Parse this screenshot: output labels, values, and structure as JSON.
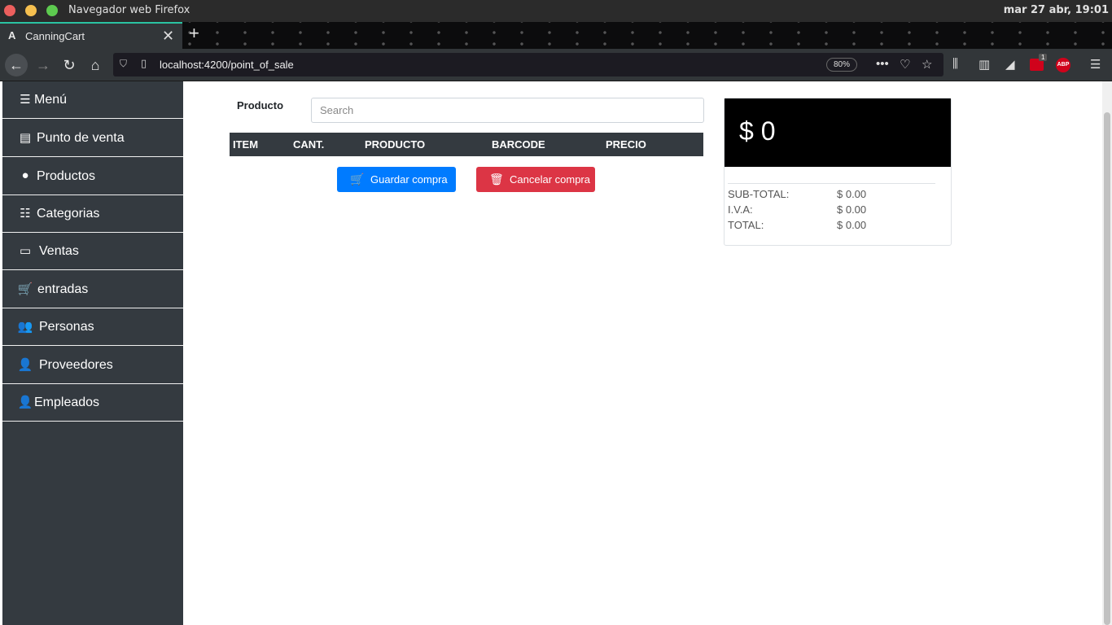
{
  "os": {
    "app_title": "Navegador web Firefox",
    "clock": "mar 27 abr, 19:01"
  },
  "browser": {
    "tab_title": "CanningCart",
    "tab_favicon": "A",
    "url": "localhost:4200/point_of_sale",
    "zoom": "80%",
    "extension_badge": "1",
    "abp_label": "ABP"
  },
  "sidebar": {
    "items": [
      {
        "label": "Menú",
        "icon": "bars-icon",
        "glyph": "☰"
      },
      {
        "label": "Punto de venta",
        "icon": "cash-register-icon",
        "glyph": "▤"
      },
      {
        "label": "Productos",
        "icon": "cookie-icon",
        "glyph": "●"
      },
      {
        "label": "Categorias",
        "icon": "list-icon",
        "glyph": "☷"
      },
      {
        "label": "Ventas",
        "icon": "money-bill-icon",
        "glyph": "▭"
      },
      {
        "label": "entradas",
        "icon": "shopping-cart-icon",
        "glyph": "🛒"
      },
      {
        "label": "Personas",
        "icon": "users-icon",
        "glyph": "👥"
      },
      {
        "label": "Proveedores",
        "icon": "user-tag-icon",
        "glyph": "👤"
      },
      {
        "label": "Empleados",
        "icon": "user-tie-icon",
        "glyph": "👤"
      }
    ]
  },
  "main": {
    "product_label": "Producto",
    "search_placeholder": "Search",
    "table_headers": [
      "ITEM",
      "CANT.",
      "PRODUCTO",
      "BARCODE",
      "PRECIO"
    ],
    "save_button": "Guardar compra",
    "cancel_button": "Cancelar compra"
  },
  "summary": {
    "total_display": "$ 0",
    "rows": [
      {
        "label": "SUB-TOTAL:",
        "value": "$ 0.00"
      },
      {
        "label": "I.V.A:",
        "value": "$ 0.00"
      },
      {
        "label": "TOTAL:",
        "value": "$ 0.00"
      }
    ]
  },
  "colors": {
    "sidebar_bg": "#343a40",
    "primary": "#007bff",
    "danger": "#dc3545",
    "tab_accent": "#2ac3a2"
  }
}
